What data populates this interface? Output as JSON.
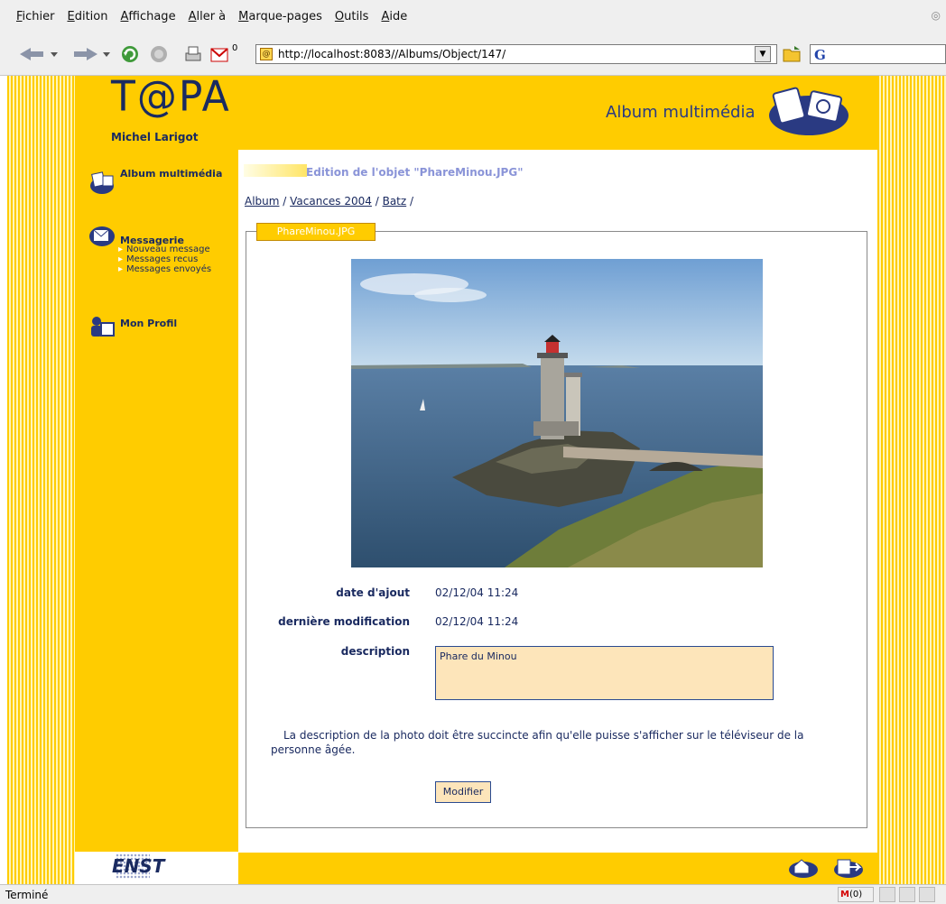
{
  "menu": {
    "items": [
      {
        "first": "F",
        "rest": "ichier"
      },
      {
        "first": "E",
        "rest": "dition"
      },
      {
        "first": "A",
        "rest": "ffichage"
      },
      {
        "first": "A",
        "rest": "ller à"
      },
      {
        "first": "M",
        "rest": "arque-pages"
      },
      {
        "first": "O",
        "rest": "utils"
      },
      {
        "first": "A",
        "rest": "ide"
      }
    ]
  },
  "toolbar": {
    "url": "http://localhost:8083//Albums/Object/147/",
    "search_glyph": "G",
    "mail_badge": "0"
  },
  "header": {
    "logo": "T@PA",
    "user": "Michel Larigot",
    "title": "Album multimédia"
  },
  "sidebar": {
    "album": "Album multimédia",
    "messagerie": "Messagerie",
    "sub": [
      "Nouveau message",
      "Messages recus",
      "Messages envoyés"
    ],
    "profil": "Mon Profil"
  },
  "content": {
    "heading": "Edition de l'objet \"PhareMinou.JPG\"",
    "breadcrumb": [
      {
        "label": "Album",
        "link": true
      },
      {
        "label": "Vacances 2004",
        "link": true
      },
      {
        "label": "Batz",
        "link": true
      }
    ],
    "legend": "PhareMinou.JPG",
    "fields": {
      "date_label": "date d'ajout",
      "date_value": "02/12/04 11:24",
      "modif_label": "dernière modification",
      "modif_value": "02/12/04 11:24",
      "desc_label": "description",
      "desc_value": "Phare du Minou"
    },
    "note": "La description de la photo doit être succincte afin qu'elle puisse s'afficher sur le téléviseur de la personne âgée.",
    "button": "Modifier"
  },
  "footer": {
    "org": "ENST"
  },
  "status": {
    "text": "Terminé",
    "mail_count": "(0)"
  }
}
